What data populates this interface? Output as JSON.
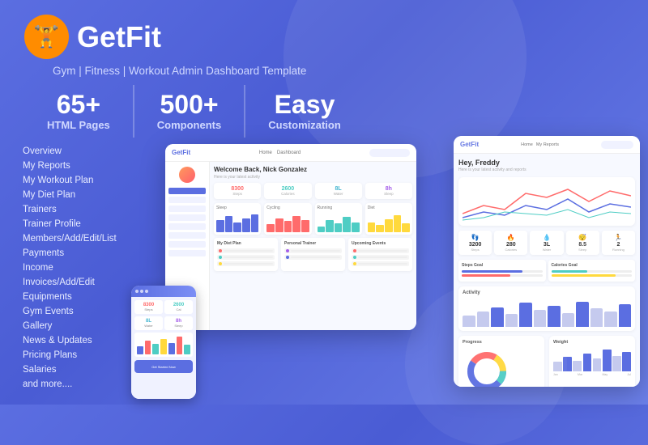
{
  "brand": {
    "name": "GetFit",
    "tagline": "Gym | Fitness | Workout Admin Dashboard Template"
  },
  "stats": [
    {
      "number": "65+",
      "label": "HTML Pages"
    },
    {
      "number": "500+",
      "label": "Components"
    },
    {
      "number": "Easy",
      "label": "Customization"
    }
  ],
  "nav": {
    "items": [
      "Overview",
      "My Reports",
      "My Workout Plan",
      "My Diet Plan",
      "Trainers",
      "Trainer Profile",
      "Members/Add/Edit/List",
      "Payments",
      "Income",
      "Invoices/Add/Edit",
      "Equipments",
      "Gym Events",
      "Gallery",
      "News & Updates",
      "Pricing Plans",
      "Salaries",
      "and more...."
    ]
  },
  "dashboard": {
    "welcome": "Welcome Back,",
    "user": "Nick Gonzalez",
    "subtitle": "Here is your latest activity and reports",
    "stats": [
      {
        "num": "8300",
        "label": "Steps",
        "color": "#ff6b6b"
      },
      {
        "num": "2600",
        "label": "Calories",
        "color": "#4ecdc4"
      },
      {
        "num": "8L",
        "label": "Water",
        "color": "#45b7d1"
      },
      {
        "num": "8h",
        "label": "Sleep",
        "color": "#96ceb4"
      }
    ],
    "charts": [
      {
        "title": "Sleep",
        "color": "#5b6ee1"
      },
      {
        "title": "Cycling",
        "color": "#ff6b6b"
      },
      {
        "title": "Running",
        "color": "#4ecdc4"
      },
      {
        "title": "Diet",
        "color": "#ffd93d"
      }
    ]
  },
  "right_dashboard": {
    "welcome": "Hey, Freddy",
    "subtitle": "Here is your latest activity and reports",
    "stats": [
      {
        "num": "3200",
        "label": "Steps",
        "icon": "👣"
      },
      {
        "num": "280",
        "label": "Calories",
        "icon": "🔥"
      },
      {
        "num": "3L",
        "label": "Water",
        "icon": "💧"
      },
      {
        "num": "8.5",
        "label": "Sleep",
        "icon": "😴"
      },
      {
        "num": "2",
        "label": "Running",
        "icon": "🏃"
      }
    ],
    "activity_title": "Activity",
    "progress_title": "Progress",
    "weight_title": "Weight"
  },
  "colors": {
    "primary": "#5b6ee1",
    "bg": "#5b6ee1",
    "orange": "#ff8c00",
    "green": "#4ecdc4",
    "red": "#ff6b6b",
    "yellow": "#ffd93d",
    "purple": "#a55eea"
  }
}
